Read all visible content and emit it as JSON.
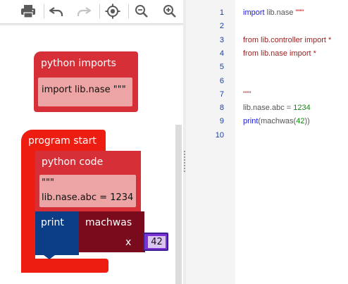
{
  "toolbar": {
    "buttons": [
      {
        "name": "print-icon",
        "icon": "printer"
      },
      {
        "name": "undo-icon",
        "icon": "undo-arrow"
      },
      {
        "name": "redo-icon",
        "icon": "redo-arrow"
      },
      {
        "name": "target-icon",
        "icon": "crosshair-target"
      },
      {
        "name": "zoom-out-icon",
        "icon": "magnifier-minus"
      },
      {
        "name": "zoom-in-icon",
        "icon": "magnifier-plus"
      }
    ]
  },
  "blocks": {
    "imports": {
      "title": "python imports",
      "code": "import lib.nase \"\"\""
    },
    "program_start": {
      "title": "program start"
    },
    "python_code": {
      "title": "python code",
      "line1": "\"\"\"",
      "line2": "lib.nase.abc = 1234"
    },
    "print": {
      "label": "print"
    },
    "machwas": {
      "label": "machwas",
      "param": "x",
      "value": "42"
    }
  },
  "editor": {
    "lines": [
      {
        "n": "1",
        "parts": [
          {
            "t": "import",
            "c": "kw"
          },
          {
            "t": " lib.nase ",
            "c": "grey"
          },
          {
            "t": "\"\"\"",
            "c": "str"
          }
        ]
      },
      {
        "n": "2",
        "parts": []
      },
      {
        "n": "3",
        "parts": [
          {
            "t": "from lib.controller import *",
            "c": "red"
          }
        ]
      },
      {
        "n": "4",
        "parts": [
          {
            "t": "from lib.nase import *",
            "c": "red"
          }
        ]
      },
      {
        "n": "5",
        "parts": []
      },
      {
        "n": "6",
        "parts": []
      },
      {
        "n": "7",
        "parts": [
          {
            "t": "\"\"\"",
            "c": "str"
          }
        ]
      },
      {
        "n": "8",
        "parts": [
          {
            "t": "lib.nase.abc = ",
            "c": "grey"
          },
          {
            "t": "1234",
            "c": "num"
          }
        ]
      },
      {
        "n": "9",
        "parts": [
          {
            "t": "print",
            "c": "kw"
          },
          {
            "t": "(machwas(",
            "c": "grey"
          },
          {
            "t": "42",
            "c": "num"
          },
          {
            "t": "))",
            "c": "grey"
          }
        ]
      },
      {
        "n": "10",
        "parts": []
      }
    ]
  },
  "colors": {
    "python_block": "#d62f37",
    "program_start": "#ee1d12",
    "print_block": "#0b3e87",
    "function_block": "#7a0b1d",
    "number_block": "#7d32d6"
  }
}
